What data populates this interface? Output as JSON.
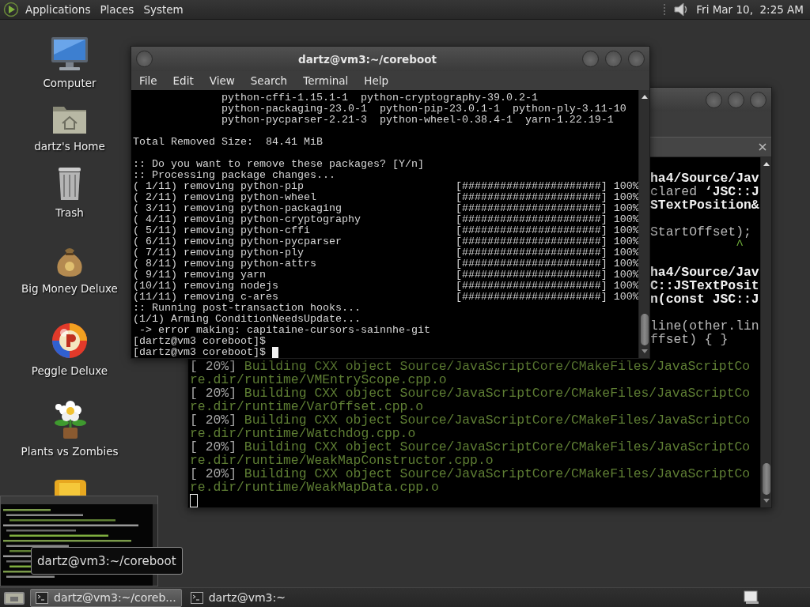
{
  "top_panel": {
    "menus": [
      "Applications",
      "Places",
      "System"
    ],
    "clock": "Fri Mar 10,  2:25 AM"
  },
  "desktop_icons": [
    {
      "kind": "computer",
      "label": "Computer"
    },
    {
      "kind": "home",
      "label": "dartz's Home"
    },
    {
      "kind": "trash",
      "label": "Trash"
    },
    {
      "kind": "money",
      "label": "Big Money Deluxe"
    },
    {
      "kind": "ball",
      "label": "Peggle Deluxe"
    },
    {
      "kind": "flower",
      "label": "Plants vs Zombies"
    },
    {
      "kind": "game"
    }
  ],
  "back_terminal": {
    "focused": false,
    "right_edge_lines": [
      {
        "kind": "bold",
        "text": "ha4/Source/Jav"
      },
      {
        "kind": "plain",
        "text": "clared **‘JSC::J**"
      },
      {
        "kind": "bold",
        "text": "STextPosition&"
      },
      {
        "kind": "blank"
      },
      {
        "kind": "plain",
        "text": "StartOffset);"
      },
      {
        "kind": "caret",
        "text": "           ^"
      },
      {
        "kind": "blank"
      },
      {
        "kind": "bold",
        "text": "ha4/Source/Jav"
      },
      {
        "kind": "bold",
        "text": "C::JSTextPosit"
      },
      {
        "kind": "bold",
        "text": "n(const JSC::J"
      },
      {
        "kind": "blank"
      },
      {
        "kind": "plain",
        "text": "line(other.lin"
      },
      {
        "kind": "plain",
        "text": "ffset) { }"
      },
      {
        "kind": "blank"
      }
    ],
    "lines": [
      {
        "kind": "build",
        "prefix": "[ 20%]",
        "text": " Building CXX object Source/JavaScriptCore/CMakeFiles/JavaScriptCo"
      },
      {
        "kind": "path",
        "text": "re.dir/runtime/VMEntryScope.cpp.o"
      },
      {
        "kind": "build",
        "prefix": "[ 20%]",
        "text": " Building CXX object Source/JavaScriptCore/CMakeFiles/JavaScriptCo"
      },
      {
        "kind": "path",
        "text": "re.dir/runtime/VarOffset.cpp.o"
      },
      {
        "kind": "build",
        "prefix": "[ 20%]",
        "text": " Building CXX object Source/JavaScriptCore/CMakeFiles/JavaScriptCo"
      },
      {
        "kind": "path",
        "text": "re.dir/runtime/Watchdog.cpp.o"
      },
      {
        "kind": "build",
        "prefix": "[ 20%]",
        "text": " Building CXX object Source/JavaScriptCore/CMakeFiles/JavaScriptCo"
      },
      {
        "kind": "path",
        "text": "re.dir/runtime/WeakMapConstructor.cpp.o"
      },
      {
        "kind": "build",
        "prefix": "[ 20%]",
        "text": " Building CXX object Source/JavaScriptCore/CMakeFiles/JavaScriptCo"
      },
      {
        "kind": "path",
        "text": "re.dir/runtime/WeakMapData.cpp.o"
      },
      {
        "kind": "cursor"
      }
    ]
  },
  "front_terminal": {
    "focused": true,
    "title": "dartz@vm3:~/coreboot",
    "menu": [
      "File",
      "Edit",
      "View",
      "Search",
      "Terminal",
      "Help"
    ],
    "lines": [
      {
        "kind": "text",
        "text": "              python-cffi-1.15.1-1  python-cryptography-39.0.2-1"
      },
      {
        "kind": "text",
        "text": "              python-packaging-23.0-1  python-pip-23.0.1-1  python-ply-3.11-10"
      },
      {
        "kind": "text",
        "text": "              python-pycparser-2.21-3  python-wheel-0.38.4-1  yarn-1.22.19-1"
      },
      {
        "kind": "blank"
      },
      {
        "kind": "text",
        "text": "Total Removed Size:  84.41 MiB"
      },
      {
        "kind": "blank"
      },
      {
        "kind": "text",
        "text": ":: Do you want to remove these packages? [Y/n]"
      },
      {
        "kind": "text",
        "text": ":: Processing package changes..."
      },
      {
        "kind": "progress",
        "text": "( 1/11) removing python-pip",
        "bar": "[######################]",
        "percent": "100%"
      },
      {
        "kind": "progress",
        "text": "( 2/11) removing python-wheel",
        "bar": "[######################]",
        "percent": "100%"
      },
      {
        "kind": "progress",
        "text": "( 3/11) removing python-packaging",
        "bar": "[######################]",
        "percent": "100%"
      },
      {
        "kind": "progress",
        "text": "( 4/11) removing python-cryptography",
        "bar": "[######################]",
        "percent": "100%"
      },
      {
        "kind": "progress",
        "text": "( 5/11) removing python-cffi",
        "bar": "[######################]",
        "percent": "100%"
      },
      {
        "kind": "progress",
        "text": "( 6/11) removing python-pycparser",
        "bar": "[######################]",
        "percent": "100%"
      },
      {
        "kind": "progress",
        "text": "( 7/11) removing python-ply",
        "bar": "[######################]",
        "percent": "100%"
      },
      {
        "kind": "progress",
        "text": "( 8/11) removing python-attrs",
        "bar": "[######################]",
        "percent": "100%"
      },
      {
        "kind": "progress",
        "text": "( 9/11) removing yarn",
        "bar": "[######################]",
        "percent": "100%"
      },
      {
        "kind": "progress",
        "text": "(10/11) removing nodejs",
        "bar": "[######################]",
        "percent": "100%"
      },
      {
        "kind": "progress",
        "text": "(11/11) removing c-ares",
        "bar": "[######################]",
        "percent": "100%"
      },
      {
        "kind": "text",
        "text": ":: Running post-transaction hooks..."
      },
      {
        "kind": "text",
        "text": "(1/1) Arming ConditionNeedsUpdate..."
      },
      {
        "kind": "text",
        "text": " -> error making: capitaine-cursors-sainnhe-git"
      },
      {
        "kind": "text",
        "text": "[dartz@vm3 coreboot]$"
      },
      {
        "kind": "text",
        "text": "[dartz@vm3 coreboot]$",
        "cursor": true
      }
    ]
  },
  "window_preview": {
    "tooltip": "dartz@vm3:~/coreboot"
  },
  "taskbar": {
    "tasks": [
      {
        "label": "dartz@vm3:~/coreb...",
        "selected": true
      },
      {
        "label": "dartz@vm3:~",
        "selected": false
      }
    ]
  }
}
